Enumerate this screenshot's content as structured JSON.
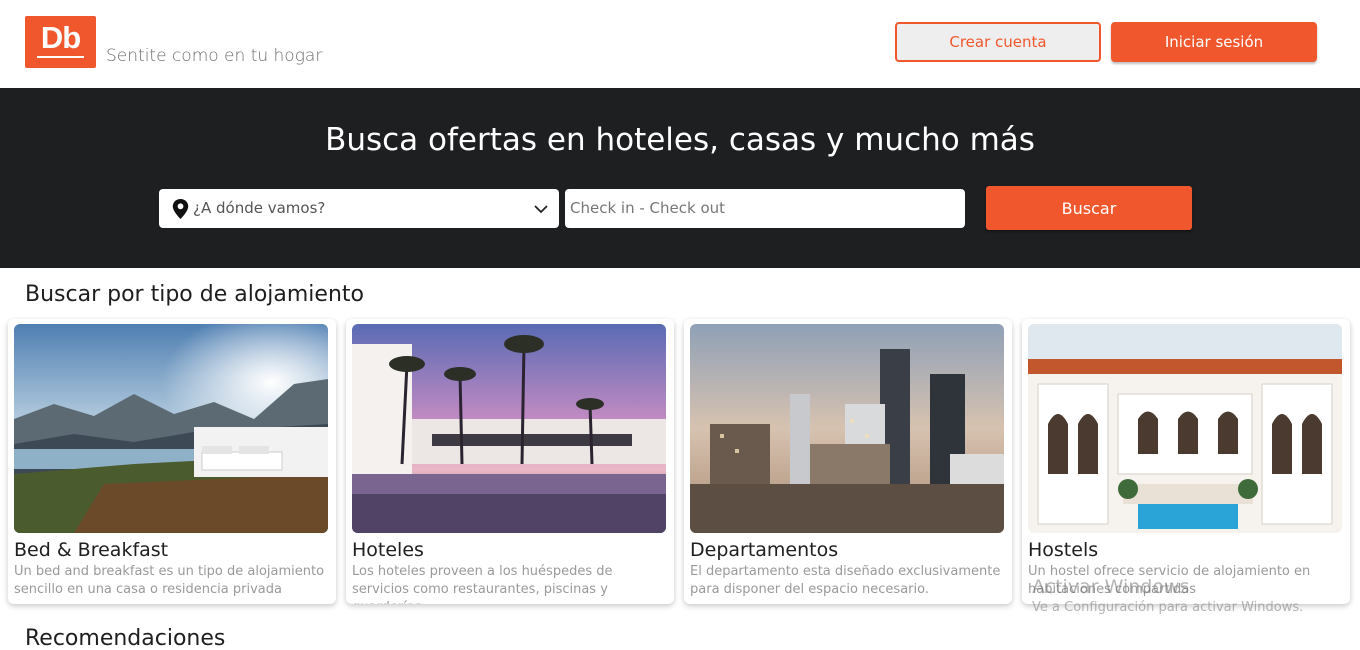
{
  "header": {
    "logo_text": "Db",
    "tagline": "Sentite como en tu hogar",
    "create_account_label": "Crear cuenta",
    "login_label": "Iniciar sesión"
  },
  "hero": {
    "title": "Busca ofertas en hoteles, casas y mucho más",
    "destination_placeholder": "¿A dónde vamos?",
    "dates_placeholder": "Check in - Check out",
    "search_label": "Buscar"
  },
  "categories_section": {
    "title": "Buscar por tipo de alojamiento",
    "cards": [
      {
        "title": "Bed & Breakfast",
        "description": "Un bed and breakfast es un tipo de alojamiento sencillo en una casa o residencia privada"
      },
      {
        "title": "Hoteles",
        "description": "Los hoteles proveen a los huéspedes de servicios como restaurantes, piscinas y guarderías"
      },
      {
        "title": "Departamentos",
        "description": "El departamento esta diseñado exclusivamente para disponer del espacio necesario."
      },
      {
        "title": "Hostels",
        "description": "Un hostel ofrece servicio de alojamiento en habitaciones compartidas"
      }
    ]
  },
  "recommendations_section": {
    "title": "Recomendaciones"
  },
  "watermark": {
    "line1": "Activar Windows",
    "line2": "Ve a Configuración para activar Windows."
  },
  "colors": {
    "accent": "#f0572d",
    "hero_bg": "#1e1f21"
  },
  "icons": [
    "location-pin-icon",
    "chevron-down-icon"
  ]
}
